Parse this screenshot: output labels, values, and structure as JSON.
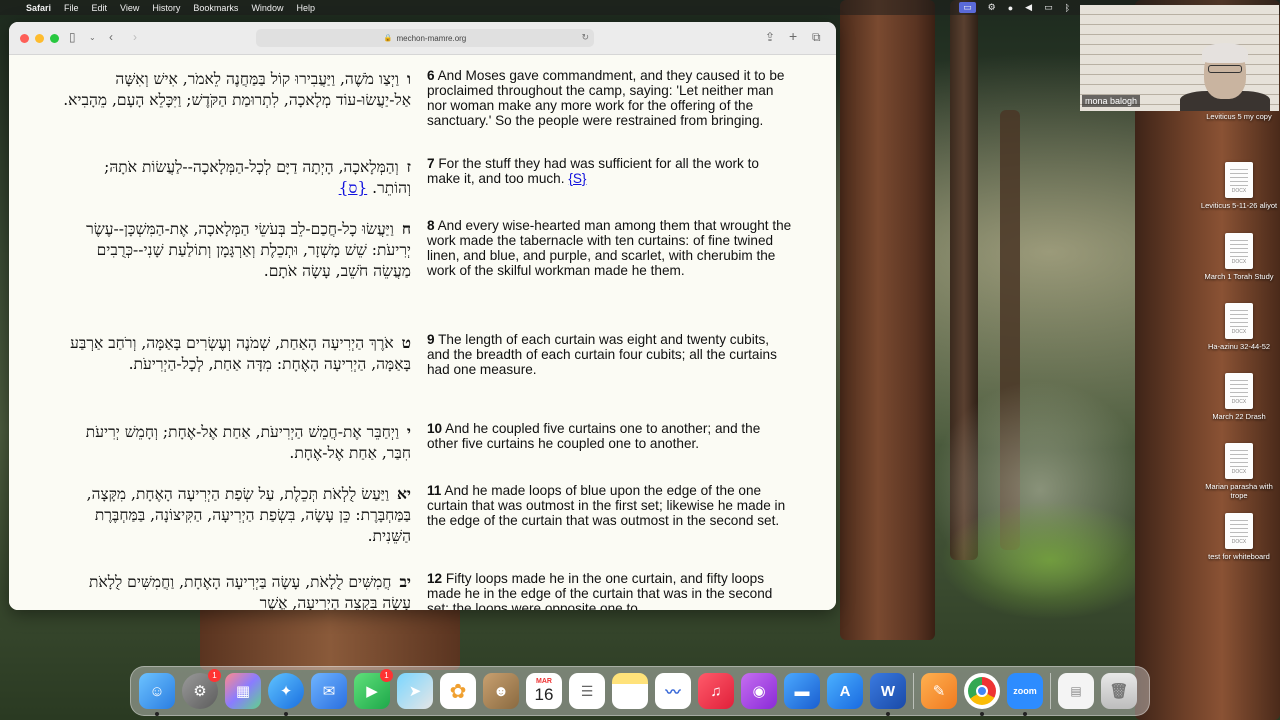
{
  "menubar": {
    "app": "Safari",
    "items": [
      "File",
      "Edit",
      "View",
      "History",
      "Bookmarks",
      "Window",
      "Help"
    ]
  },
  "browser": {
    "url": "mechon-mamre.org"
  },
  "verses": [
    {
      "heb_num": "ו",
      "hebrew": "וַיְצַו מֹשֶׁה, וַיַּעֲבִירוּ קוֹל בַּמַּחֲנֶה לֵאמֹר, אִישׁ וְאִשָּׁה אַל-יַעֲשׂוּ-עוֹד מְלָאכָה, לִתְרוּמַת הַקֹּדֶשׁ; וַיִּכָּלֵא הָעָם, מֵהָבִיא.",
      "num": "6",
      "english": "And Moses gave commandment, and they caused it to be proclaimed throughout the camp, saying: 'Let neither man nor woman make any more work for the offering of the sanctuary.' So the people were restrained from bringing.",
      "ref": ""
    },
    {
      "heb_num": "ז",
      "hebrew": "וְהַמְּלָאכָה, הָיְתָה דַיָּם לְכָל-הַמְּלָאכָה--לַעֲשׂוֹת אֹתָהּ; וְהוֹתֵר.",
      "heb_ref": "{ס}",
      "num": "7",
      "english": "For the stuff they had was sufficient for all the work to make it, and too much.",
      "ref": "{S}"
    },
    {
      "heb_num": "ח",
      "hebrew": "וַיַּעֲשׂוּ כָל-חֲכַם-לֵב בְּעֹשֵׂי הַמְּלָאכָה, אֶת-הַמִּשְׁכָּן--עֶשֶׂר יְרִיעֹת: שֵׁשׁ מָשְׁזָר, וּתְכֵלֶת וְאַרְגָּמָן וְתוֹלַעַת שָׁנִי--כְּרֻבִים מַעֲשֵׂה חֹשֵׁב, עָשָׂה אֹתָם.",
      "num": "8",
      "english": "And every wise-hearted man among them that wrought the work made the tabernacle with ten curtains: of fine twined linen, and blue, and purple, and scarlet, with cherubim the work of the skilful workman made he them.",
      "ref": ""
    },
    {
      "heb_num": "ט",
      "hebrew": "אֹרֶךְ הַיְרִיעָה הָאַחַת, שְׁמֹנֶה וְעֶשְׂרִים בָּאַמָּה, וְרֹחַב אַרְבַּע בָּאַמָּה, הַיְרִיעָה הָאֶחָת: מִדָּה אַחַת, לְכָל-הַיְרִיעֹת.",
      "num": "9",
      "english": "The length of each curtain was eight and twenty cubits, and the breadth of each curtain four cubits; all the curtains had one measure.",
      "ref": ""
    },
    {
      "heb_num": "י",
      "hebrew": "וַיְחַבֵּר אֶת-חֲמֵשׁ הַיְרִיעֹת, אַחַת אֶל-אֶחָת; וְחָמֵשׁ יְרִיעֹת חִבַּר, אַחַת אֶל-אֶחָת.",
      "num": "10",
      "english": "And he coupled five curtains one to another; and the other five curtains he coupled one to another.",
      "ref": ""
    },
    {
      "heb_num": "יא",
      "hebrew": "וַיַּעַשׂ לֻלְאֹת תְּכֵלֶת, עַל שְׂפַת הַיְרִיעָה הָאֶחָת, מִקָּצָה, בַּמַּחְבָּרֶת: כֵּן עָשָׂה, בִּשְׂפַת הַיְרִיעָה, הַקִּיצוֹנָה, בַּמַּחְבֶּרֶת הַשֵּׁנִית.",
      "num": "11",
      "english": "And he made loops of blue upon the edge of the one curtain that was outmost in the first set; likewise he made in the edge of the curtain that was outmost in the second set.",
      "ref": ""
    },
    {
      "heb_num": "יב",
      "hebrew": "חֲמִשִּׁים לֻלָאֹת, עָשָׂה בַּיְרִיעָה הָאֶחָת, וַחֲמִשִּׁים לֻלָאֹת עָשָׂה בִּקְצֵה הַיְרִיעָה, אֲשֶׁר",
      "num": "12",
      "english": "Fifty loops made he in the one curtain, and fifty loops made he in the edge of the curtain that was in the second set; the loops were opposite one to",
      "ref": ""
    }
  ],
  "zoom": {
    "participant_name": "mona balogh"
  },
  "desktop_icons": [
    {
      "label": "Leviticus 5 my copy",
      "type": "DOCX"
    },
    {
      "label": "Leviticus 5-11-26 aliyot",
      "type": "DOCX"
    },
    {
      "label": "March 1 Torah Study",
      "type": "DOCX"
    },
    {
      "label": "Ha-azinu 32-44-52",
      "type": "DOCX"
    },
    {
      "label": "March 22 Drash",
      "type": "DOCX"
    },
    {
      "label": "Marian parasha with trope",
      "type": "DOCX"
    },
    {
      "label": "test for whiteboard",
      "type": "DOCX"
    }
  ],
  "dock": {
    "calendar_month": "MAR",
    "calendar_day": "16",
    "zoom_label": "zoom",
    "badges": {
      "settings": "1",
      "facetime": "1"
    }
  }
}
